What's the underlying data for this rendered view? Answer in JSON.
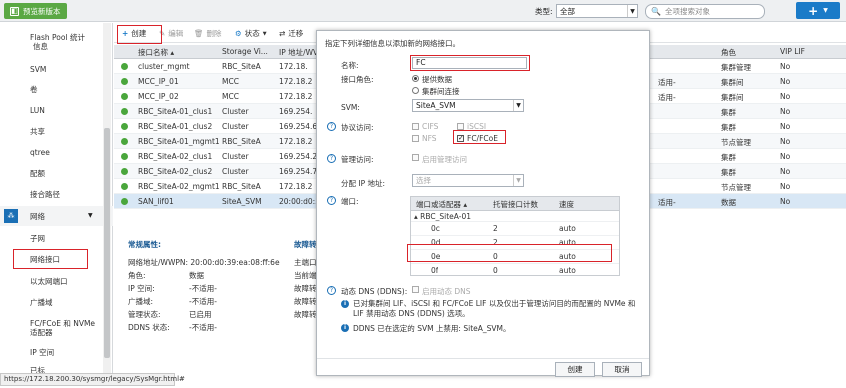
{
  "topbar": {
    "preview_label": "预览新版本",
    "type_label": "类型:",
    "type_value": "全部",
    "search_placeholder": "全项搜索对象",
    "add_symbol": "+"
  },
  "sidebar": {
    "items": [
      "Flash Pool 统计",
      "信息",
      "SVM",
      "卷",
      "LUN",
      "共享",
      "qtree",
      "配额",
      "接合路径",
      "网络",
      "子网",
      "网络接口",
      "以太网端口",
      "广播域",
      "FC/FCoE 和 NVMe",
      "适配器",
      "IP 空间",
      "已标"
    ]
  },
  "toolbar": {
    "create": "创建",
    "edit": "编辑",
    "delete": "删除",
    "status": "状态",
    "migrate": "迁移"
  },
  "grid": {
    "headers": [
      "接口名称",
      "Storage Vi...",
      "IP 地址/WV"
    ],
    "rows": [
      [
        "cluster_mgmt",
        "RBC_SiteA",
        "172.18."
      ],
      [
        "MCC_IP_01",
        "MCC",
        "172.18.2"
      ],
      [
        "MCC_IP_02",
        "MCC",
        "172.18.2"
      ],
      [
        "RBC_SiteA-01_clus1",
        "Cluster",
        "169.254."
      ],
      [
        "RBC_SiteA-01_clus2",
        "Cluster",
        "169.254.6"
      ],
      [
        "RBC_SiteA-01_mgmt1",
        "RBC_SiteA",
        "172.18.2"
      ],
      [
        "RBC_SiteA-02_clus1",
        "Cluster",
        "169.254.2"
      ],
      [
        "RBC_SiteA-02_clus2",
        "Cluster",
        "169.254.7"
      ],
      [
        "RBC_SiteA-02_mgmt1",
        "RBC_SiteA",
        "172.18.2"
      ],
      [
        "SAN_lif01",
        "SiteA_SVM",
        "20:00:d0:3"
      ]
    ]
  },
  "grid2": {
    "headers": [
      "角色",
      "VIP LIF"
    ],
    "rows": [
      [
        "",
        "集群管理",
        "No"
      ],
      [
        "适用-",
        "集群间",
        "No"
      ],
      [
        "适用-",
        "集群间",
        "No"
      ],
      [
        "",
        "集群",
        "No"
      ],
      [
        "",
        "集群",
        "No"
      ],
      [
        "",
        "节点管理",
        "No"
      ],
      [
        "",
        "集群",
        "No"
      ],
      [
        "",
        "集群",
        "No"
      ],
      [
        "",
        "节点管理",
        "No"
      ],
      [
        "适用-",
        "数据",
        "No"
      ]
    ]
  },
  "details": {
    "title": "常规属性:",
    "failover_title": "故障转",
    "wwpn": "网络地址/WWPN: 20:00:d0:39:ea:08:ff:6e",
    "rows": [
      [
        "角色:",
        "数据"
      ],
      [
        "IP 空间:",
        "-不适用-"
      ],
      [
        "广播域:",
        "-不适用-"
      ],
      [
        "管理状态:",
        "已启用"
      ],
      [
        "DDNS 状态:",
        "-不适用-"
      ]
    ],
    "failover": [
      "主端口",
      "当前端",
      "故障转",
      "故障转",
      "故障转"
    ]
  },
  "dialog": {
    "instruction": "指定下列详细信息以添加新的网络接口。",
    "name_label": "名称:",
    "name_value": "FC",
    "role_label": "接口角色:",
    "role_data": "提供数据",
    "role_intercluster": "集群间连接",
    "svm_label": "SVM:",
    "svm_value": "SiteA_SVM",
    "protocol_label": "协议访问:",
    "cifs": "CIFS",
    "iscsi": "iSCSI",
    "nfs": "NFS",
    "fc": "FC/FCoE",
    "mgmt_label": "管理访问:",
    "mgmt_option": "启用管理访问",
    "ip_label": "分配 IP 地址:",
    "ip_value": "选择",
    "port_label": "端口:",
    "port_headers": [
      "端口或适配器",
      "托管接口计数",
      "速度"
    ],
    "port_group": "RBC_SiteA-01",
    "ports": [
      [
        "0c",
        "2",
        "auto"
      ],
      [
        "0d",
        "2",
        "auto"
      ],
      [
        "0e",
        "0",
        "auto"
      ],
      [
        "0f",
        "0",
        "auto"
      ]
    ],
    "ddns_label": "动态 DNS (DDNS):",
    "ddns_option": "启用动态 DNS",
    "note1": "已对集群间 LIF、iSCSI 和 FC/FCoE LIF 以及仅出于管理访问目的而配置的 NVMe 和 LIF 禁用动态 DNS (DDNS) 选项。",
    "note2": "DDNS 已在选定的 SVM 上禁用: SiteA_SVM。",
    "create_btn": "创建",
    "cancel_btn": "取消"
  },
  "statusbar": {
    "url": "https://172.18.200.30/sysmgr/legacy/SysMgr.html#"
  }
}
